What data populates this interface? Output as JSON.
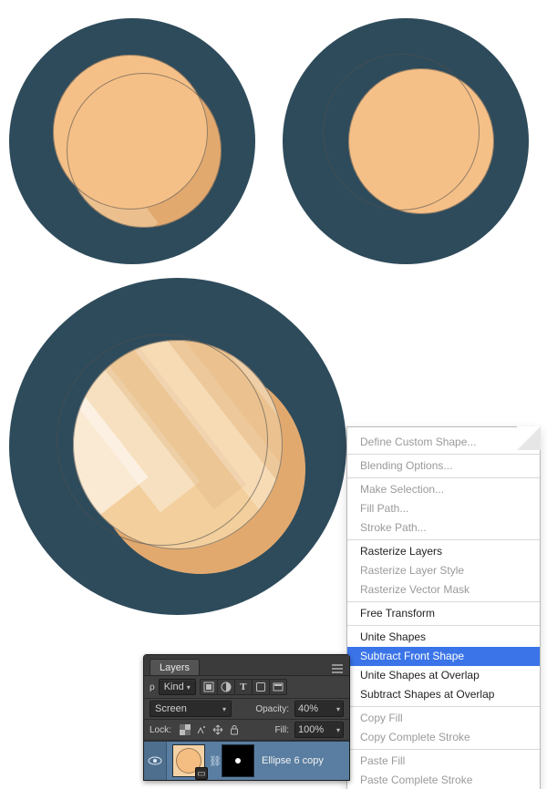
{
  "ctx": {
    "items": [
      "Define Custom Shape...",
      "Blending Options...",
      "Make Selection...",
      "Fill Path...",
      "Stroke Path...",
      "Rasterize Layers",
      "Rasterize Layer Style",
      "Rasterize Vector Mask",
      "Free Transform",
      "Unite Shapes",
      "Subtract Front Shape",
      "Unite Shapes at Overlap",
      "Subtract Shapes at Overlap",
      "Copy Fill",
      "Copy Complete Stroke",
      "Paste Fill",
      "Paste Complete Stroke"
    ],
    "selected_index": 10,
    "disabled_indexes": [
      0,
      1,
      2,
      3,
      4,
      6,
      7,
      13,
      14,
      15,
      16
    ]
  },
  "layers": {
    "tab": "Layers",
    "filter_kind": "Kind",
    "blend_mode": "Screen",
    "opacity_label": "Opacity:",
    "opacity": "40%",
    "lock_label": "Lock:",
    "fill_label": "Fill:",
    "fill": "100%",
    "layer_name": "Ellipse 6 copy"
  },
  "colors": {
    "bg_circle": "#2e4b5b",
    "coin_face": "#f5c087",
    "coin_shadow": "#e2a96f",
    "menu_highlight": "#3a74e8"
  }
}
